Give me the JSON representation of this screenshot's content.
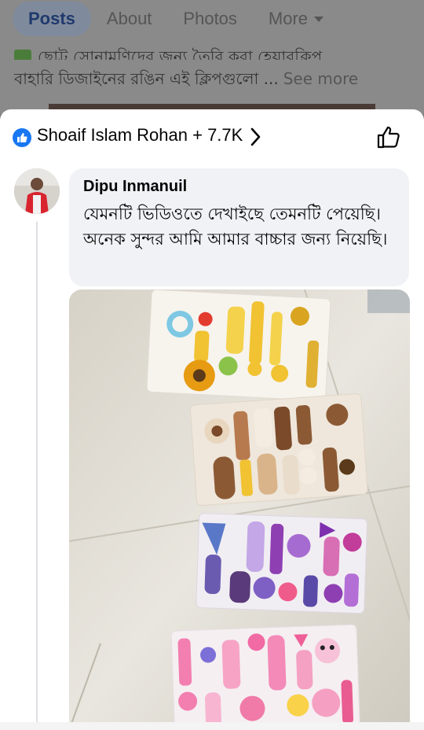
{
  "tabs": {
    "posts": "Posts",
    "about": "About",
    "photos": "Photos",
    "more": "More"
  },
  "post": {
    "line1": "ছোট্ট সোনামণিদের জন্য তৈরি করা হেয়ারক্লিপ",
    "line2": "বাহারি ডিজাইনের রঙিন এই ক্লিপগুলো ...",
    "see_more": "See more"
  },
  "reactions": {
    "summary": "Shoaif Islam Rohan + 7.7K"
  },
  "comment": {
    "author": "Dipu Inmanuil",
    "text": "যেমনটি ভিডিওতে দেখাইছে তেমনটি পেয়েছি। অনেক সুন্দর আমি আমার বাচ্চার জন্য নিয়েছি।"
  },
  "colors": {
    "facebook_blue": "#1877f2",
    "bubble_bg": "#f0f2f5",
    "text": "#050505"
  }
}
